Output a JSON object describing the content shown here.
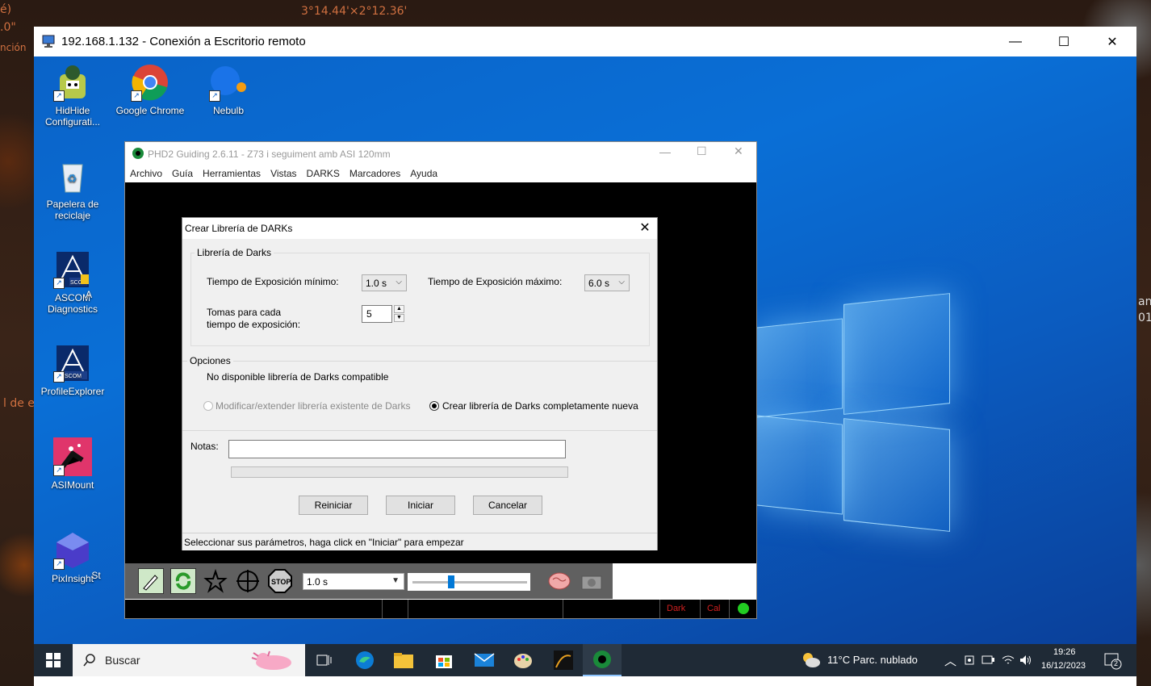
{
  "background": {
    "text_top": "3°14.44'×2°12.36'",
    "text_left_1": "é)",
    "text_left_2": ".0\"",
    "text_left_3": "nción",
    "text_left_4": "l de e",
    "text_right_1": "an",
    "text_right_2": "01"
  },
  "rdp": {
    "title": "192.168.1.132 - Conexión a Escritorio remoto",
    "minimize": "—",
    "maximize": "☐",
    "close": "✕"
  },
  "desktop": {
    "icons": [
      {
        "label": "HidHide Configurati..."
      },
      {
        "label": "Google Chrome"
      },
      {
        "label": "Nebulb"
      },
      {
        "label": "Papelera de reciclaje"
      },
      {
        "label": "ASCOM Diagnostics"
      },
      {
        "label": "ProfileExplorer"
      },
      {
        "label": "ASIMount"
      },
      {
        "label": "PixInsight"
      }
    ],
    "partial_a": "A",
    "partial_st": "St"
  },
  "phd2": {
    "title": "PHD2 Guiding 2.6.11 - Z73 i seguiment amb ASI 120mm",
    "menu": [
      "Archivo",
      "Guía",
      "Herramientas",
      "Vistas",
      "DARKS",
      "Marcadores",
      "Ayuda"
    ],
    "exposure_select": "1.0 s",
    "status": {
      "dark": "Dark",
      "cal": "Cal"
    }
  },
  "dialog": {
    "title": "Crear Librería de DARKs",
    "close": "✕",
    "group_library": "Librería de Darks",
    "min_exp_label": "Tiempo de Exposición mínimo:",
    "min_exp_value": "1.0 s",
    "max_exp_label": "Tiempo de Exposición máximo:",
    "max_exp_value": "6.0 s",
    "frames_label_1": "Tomas para cada",
    "frames_label_2": "tiempo de exposición:",
    "frames_value": "5",
    "group_options": "Opciones",
    "no_library_text": "No disponible librería de Darks compatible",
    "radio_modify": "Modificar/extender librería existente de Darks",
    "radio_create": "Crear librería de Darks completamente nueva",
    "notes_label": "Notas:",
    "notes_value": "",
    "progress": 0,
    "btn_reset": "Reiniciar",
    "btn_start": "Iniciar",
    "btn_cancel": "Cancelar",
    "statusbar": "Seleccionar sus parámetros, haga click en \"Iniciar\" para empezar"
  },
  "taskbar": {
    "search_placeholder": "Buscar",
    "weather": "11°C  Parc. nublado",
    "time": "19:26",
    "date": "16/12/2023",
    "notif_count": "2"
  },
  "colors": {
    "desktop_blue": "#0a6fd6",
    "taskbar": "#1f2a36",
    "accent": "#0078d7"
  }
}
